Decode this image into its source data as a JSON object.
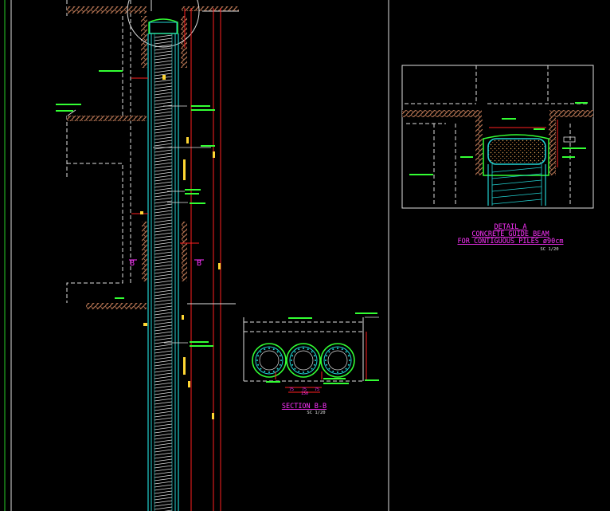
{
  "detail_a": {
    "title": "DETAIL  A",
    "line1": "CONCRETE GUIDE BEAM",
    "line2": "FOR CONTIGUOUS PILES ø90cm",
    "scale": "SC 1/20"
  },
  "section_bb": {
    "title": "SECTION  B-B",
    "scale": "SC 1/20",
    "dim_left": "75",
    "dim_mid": "75",
    "dim_right": "75",
    "dim_total": "150"
  },
  "section_mark_left": "B",
  "section_mark_right": "B",
  "colors": {
    "background": "#000000",
    "white_line": "#e0e0e0",
    "cyan_rebar": "#22d3d3",
    "red_dim": "#ff2020",
    "magenta_text": "#ff33ff",
    "green_text": "#33ff33",
    "soil_hatch": "#b07050",
    "green_frame": "#22aa22"
  }
}
